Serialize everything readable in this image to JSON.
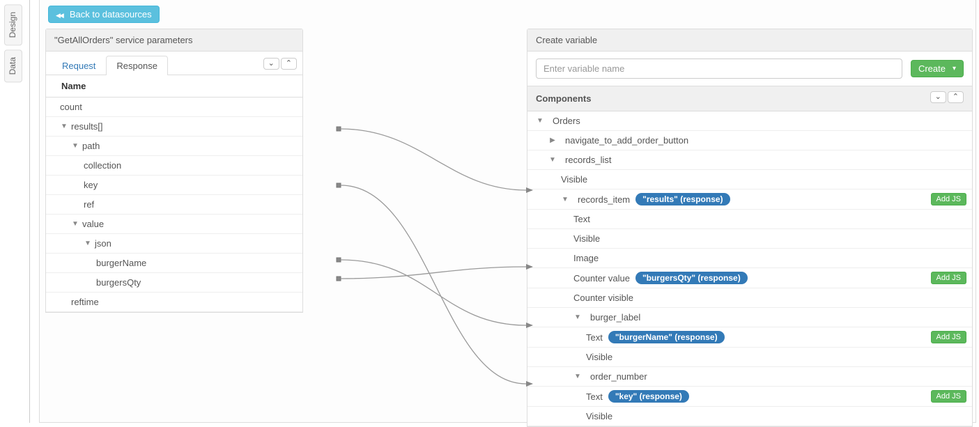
{
  "sideTabs": {
    "design": "Design",
    "data": "Data"
  },
  "backButton": "Back to datasources",
  "leftPanel": {
    "title": "\"GetAllOrders\" service parameters",
    "tabs": {
      "request": "Request",
      "response": "Response"
    },
    "columnHeader": "Name",
    "tree": {
      "count": "count",
      "results": "results[]",
      "path": "path",
      "collection": "collection",
      "key": "key",
      "ref": "ref",
      "value": "value",
      "json": "json",
      "burgerName": "burgerName",
      "burgersQty": "burgersQty",
      "reftime": "reftime"
    }
  },
  "rightPanel": {
    "createVariable": {
      "title": "Create variable",
      "placeholder": "Enter variable name",
      "button": "Create"
    },
    "componentsTitle": "Components",
    "addJs": "Add JS",
    "nodes": {
      "orders": "Orders",
      "navBtn": "navigate_to_add_order_button",
      "recordsList": "records_list",
      "visible": "Visible",
      "recordsItem": "records_item",
      "recordsItemBinding": "\"results\" (response)",
      "text": "Text",
      "image": "Image",
      "counterValue": "Counter value",
      "counterValueBinding": "\"burgersQty\" (response)",
      "counterVisible": "Counter visible",
      "burgerLabel": "burger_label",
      "burgerLabelTextBinding": "\"burgerName\" (response)",
      "orderNumber": "order_number",
      "orderNumberTextBinding": "\"key\" (response)"
    }
  }
}
